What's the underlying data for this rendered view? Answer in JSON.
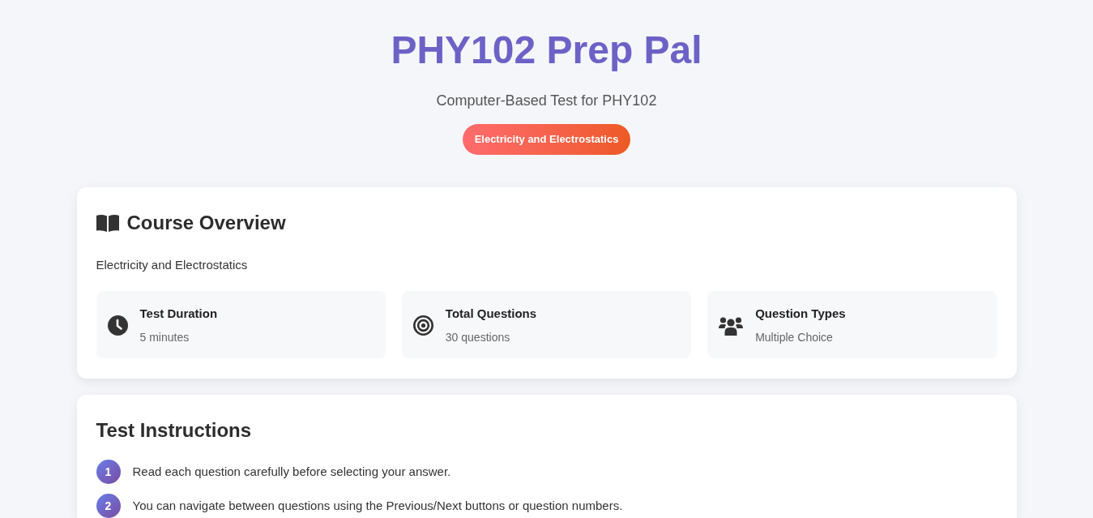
{
  "header": {
    "title": "PHY102 Prep Pal",
    "subtitle": "Computer-Based Test for PHY102",
    "badge": "Electricity and Electrostatics"
  },
  "overview": {
    "heading": "Course Overview",
    "description": "Electricity and Electrostatics",
    "stats": [
      {
        "kind": "duration",
        "label": "Test Duration",
        "value": "5 minutes"
      },
      {
        "kind": "questions",
        "label": "Total Questions",
        "value": "30 questions"
      },
      {
        "kind": "types",
        "label": "Question Types",
        "value": "Multiple Choice"
      }
    ]
  },
  "instructions": {
    "heading": "Test Instructions",
    "items": [
      {
        "number": "1",
        "text": "Read each question carefully before selecting your answer."
      },
      {
        "number": "2",
        "text": "You can navigate between questions using the Previous/Next buttons or question numbers."
      }
    ]
  }
}
